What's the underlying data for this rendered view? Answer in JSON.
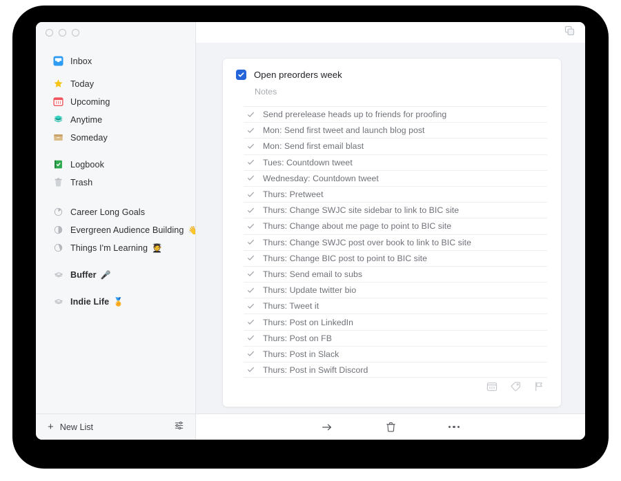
{
  "window": {
    "traffic_lights": [
      "close",
      "minimize",
      "zoom"
    ],
    "duplicate_icon": "copy-windows-icon"
  },
  "sidebar": {
    "groups": [
      {
        "items": [
          {
            "icon": "inbox-icon",
            "label": "Inbox",
            "emoji": ""
          }
        ]
      },
      {
        "items": [
          {
            "icon": "star-icon",
            "label": "Today",
            "emoji": ""
          },
          {
            "icon": "calendar-icon",
            "label": "Upcoming",
            "emoji": ""
          },
          {
            "icon": "layers-icon",
            "label": "Anytime",
            "emoji": ""
          },
          {
            "icon": "archive-box-icon",
            "label": "Someday",
            "emoji": ""
          }
        ]
      },
      {
        "items": [
          {
            "icon": "logbook-icon",
            "label": "Logbook",
            "emoji": ""
          },
          {
            "icon": "trash-icon",
            "label": "Trash",
            "emoji": ""
          }
        ]
      },
      {
        "items": [
          {
            "icon": "progress-circle-icon",
            "label": "Career Long Goals",
            "emoji": ""
          },
          {
            "icon": "progress-circle-icon",
            "label": "Evergreen Audience Building",
            "emoji": "👋"
          },
          {
            "icon": "progress-circle-icon",
            "label": "Things I'm Learning",
            "emoji": "🧑‍🎓"
          }
        ]
      },
      {
        "items": [
          {
            "icon": "area-stack-icon",
            "label": "Buffer",
            "emoji": "🎤"
          }
        ]
      },
      {
        "items": [
          {
            "icon": "area-stack-icon",
            "label": "Indie Life",
            "emoji": "🏅"
          }
        ]
      }
    ],
    "footer": {
      "new_list_label": "New List",
      "plus_glyph": "+",
      "settings_icon": "sliders-icon"
    }
  },
  "task": {
    "title": "Open preorders week",
    "completed": true,
    "checkbox_color": "#2563d9",
    "notes_placeholder": "Notes",
    "checklist": [
      {
        "text": "Send prerelease heads up to friends for proofing",
        "done": true
      },
      {
        "text": "Mon: Send first tweet and launch blog post",
        "done": true
      },
      {
        "text": "Mon: Send first email blast",
        "done": true
      },
      {
        "text": "Tues: Countdown tweet",
        "done": true
      },
      {
        "text": "Wednesday: Countdown tweet",
        "done": true
      },
      {
        "text": "Thurs: Pretweet",
        "done": true
      },
      {
        "text": "Thurs: Change SWJC site sidebar to link to BIC site",
        "done": true
      },
      {
        "text": "Thurs: Change about me page to point to BIC site",
        "done": true
      },
      {
        "text": "Thurs: Change SWJC post over book to link to BIC site",
        "done": true
      },
      {
        "text": "Thurs: Change BIC post to point to BIC site",
        "done": true
      },
      {
        "text": "Thurs: Send email to subs",
        "done": true
      },
      {
        "text": "Thurs: Update twitter bio",
        "done": true
      },
      {
        "text": "Thurs: Tweet it",
        "done": true
      },
      {
        "text": "Thurs: Post on LinkedIn",
        "done": true
      },
      {
        "text": "Thurs: Post on FB",
        "done": true
      },
      {
        "text": "Thurs: Post in Slack",
        "done": true
      },
      {
        "text": "Thurs: Post in Swift Discord",
        "done": true
      }
    ],
    "card_tools": [
      "when-calendar-icon",
      "tag-icon",
      "deadline-flag-icon"
    ]
  },
  "main_footer": {
    "buttons": [
      "move-arrow-icon",
      "delete-trash-icon",
      "more-ellipsis-icon"
    ]
  }
}
